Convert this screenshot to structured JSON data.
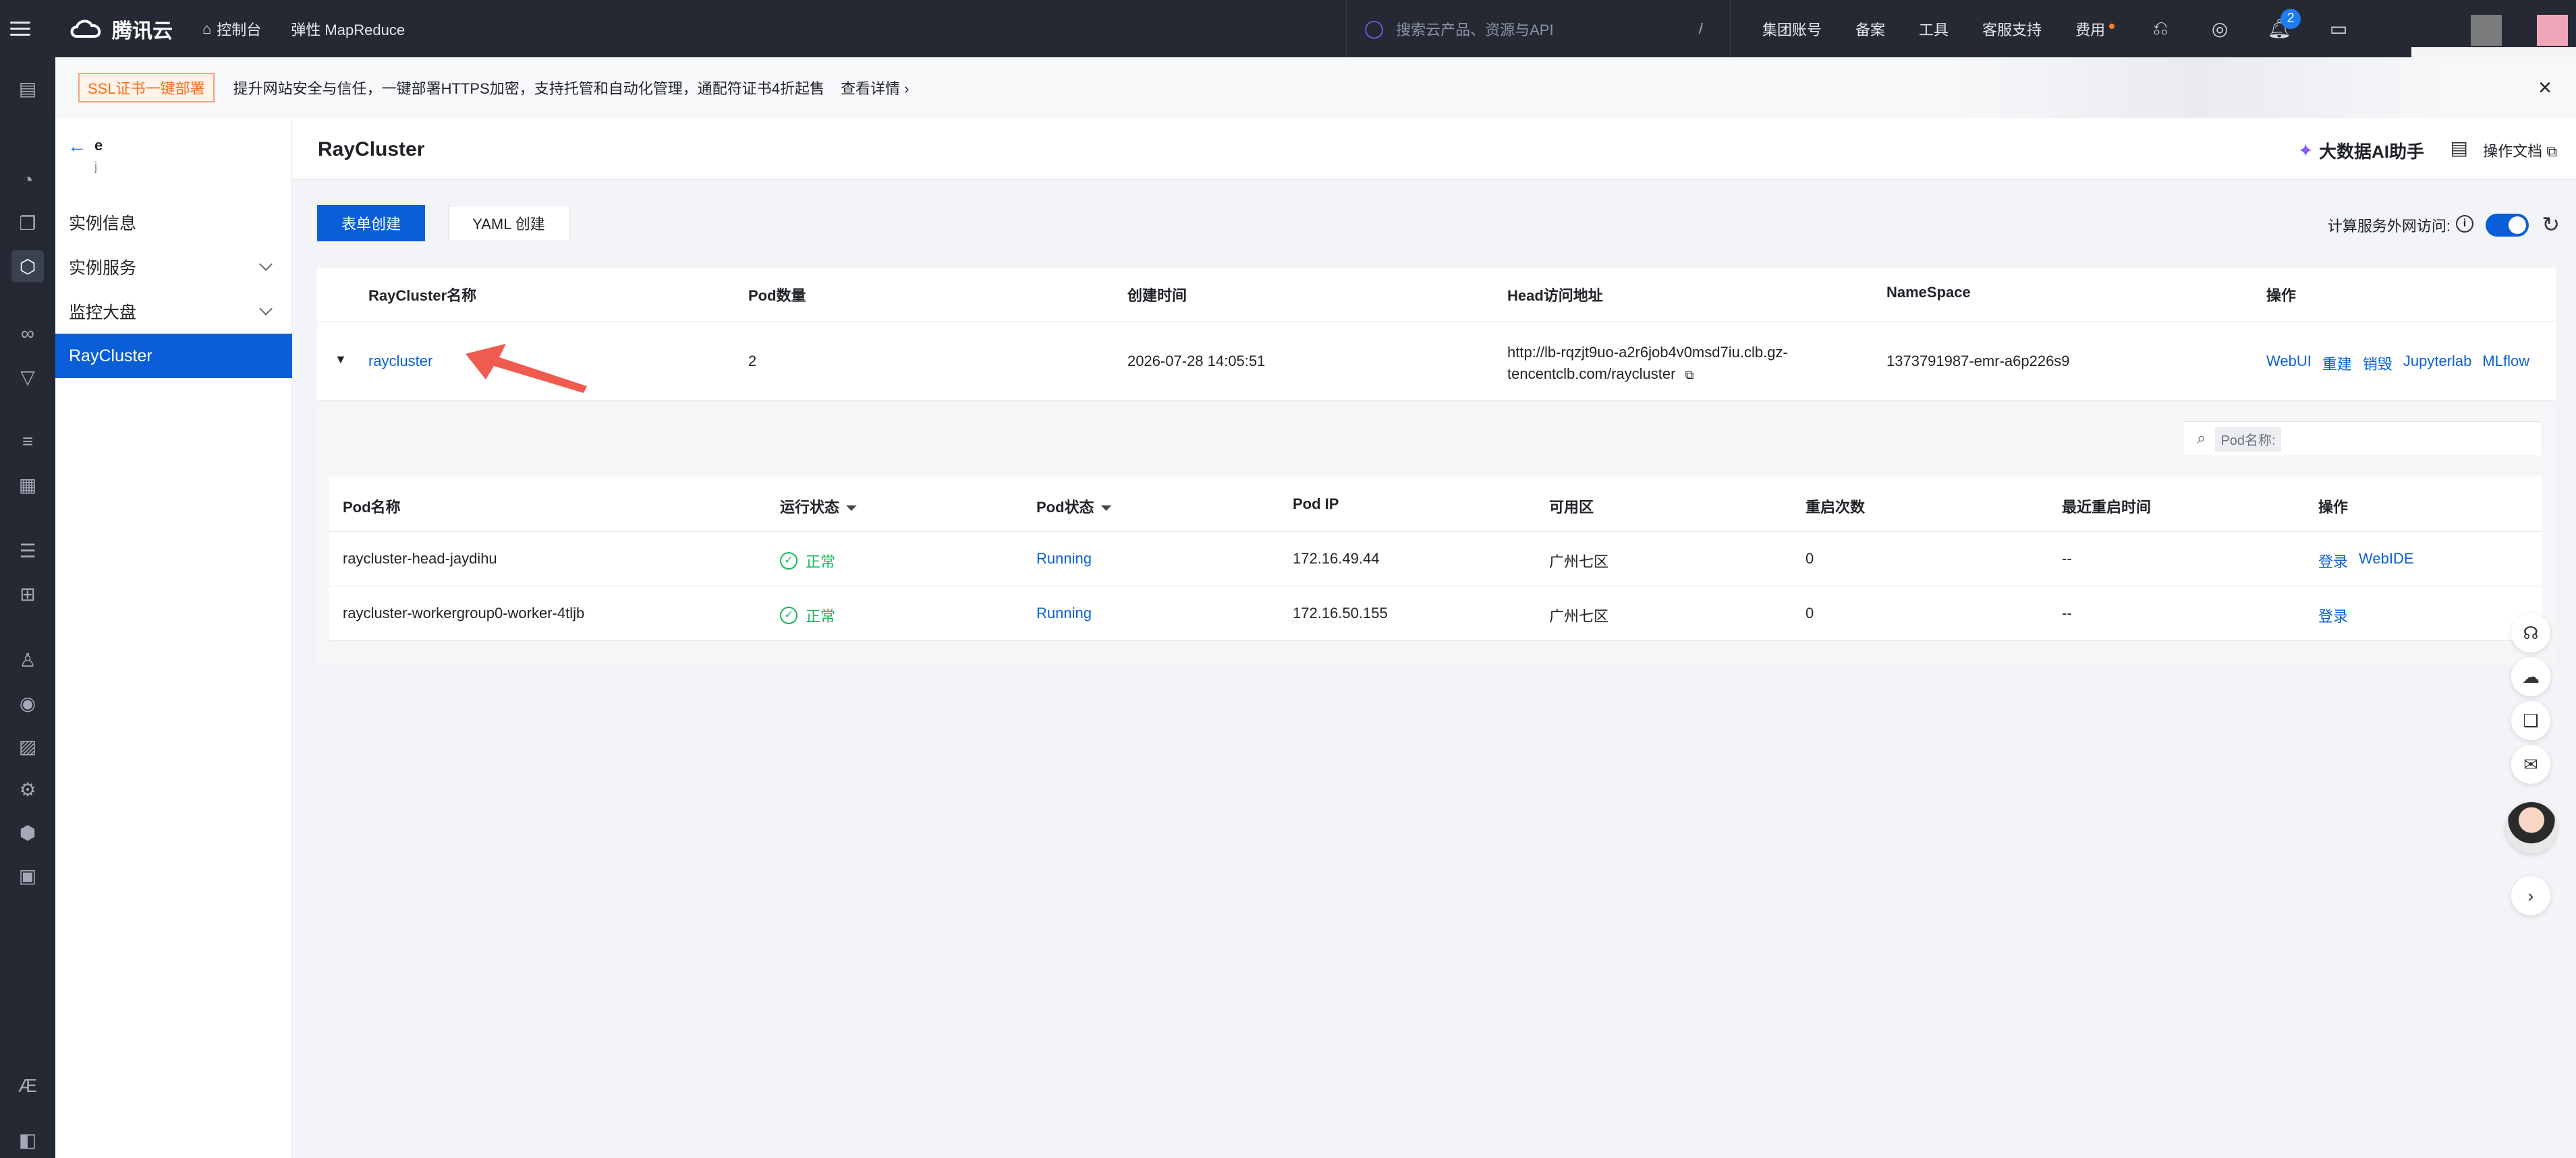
{
  "topnav": {
    "brand": "腾讯云",
    "console": "控制台",
    "product": "弹性 MapReduce",
    "search_placeholder": "搜索云产品、资源与API",
    "search_shortcut": "/",
    "links": [
      "集团账号",
      "备案",
      "工具",
      "客服支持",
      "费用"
    ],
    "notification_count": "2"
  },
  "banner": {
    "tag": "SSL证书一键部署",
    "text": "提升网站安全与信任，一键部署HTTPS加密，支持托管和自动化管理，通配符证书4折起售",
    "more": "查看详情 ›",
    "close": "×"
  },
  "subnav": {
    "instance_name": "e",
    "instance_sub": "j",
    "items": [
      {
        "label": "实例信息",
        "expandable": false
      },
      {
        "label": "实例服务",
        "expandable": true
      },
      {
        "label": "监控大盘",
        "expandable": true
      },
      {
        "label": "RayCluster",
        "expandable": false,
        "active": true
      }
    ]
  },
  "page": {
    "title": "RayCluster",
    "ai_assistant": "大数据AI助手",
    "doc_link": "操作文档",
    "btn_form": "表单创建",
    "btn_yaml": "YAML 创建",
    "net_access_label": "计算服务外网访问:",
    "net_access_enabled": true
  },
  "cluster_table": {
    "columns": [
      "RayCluster名称",
      "Pod数量",
      "创建时间",
      "Head访问地址",
      "NameSpace",
      "操作"
    ],
    "rows": [
      {
        "name": "raycluster",
        "pods": "2",
        "created": "2026-07-28 14:05:51",
        "head_url_line1": "http://lb-rqzjt9uo-a2r6job4v0msd7iu.clb.gz-",
        "head_url_line2": "tencentclb.com/raycluster",
        "namespace": "1373791987-emr-a6p226s9",
        "actions": [
          "WebUI",
          "重建",
          "销毁",
          "Jupyterlab",
          "MLflow"
        ]
      }
    ]
  },
  "pod_search": {
    "label": "Pod名称:"
  },
  "pod_table": {
    "columns": [
      "Pod名称",
      "运行状态",
      "Pod状态",
      "Pod IP",
      "可用区",
      "重启次数",
      "最近重启时间",
      "操作"
    ],
    "rows": [
      {
        "name": "raycluster-head-jaydihu",
        "run_state": "正常",
        "pod_state": "Running",
        "ip": "172.16.49.44",
        "zone": "广州七区",
        "restarts": "0",
        "last_restart": "--",
        "actions": [
          "登录",
          "WebIDE"
        ]
      },
      {
        "name": "raycluster-workergroup0-worker-4tljb",
        "run_state": "正常",
        "pod_state": "Running",
        "ip": "172.16.50.155",
        "zone": "广州七区",
        "restarts": "0",
        "last_restart": "--",
        "actions": [
          "登录"
        ]
      }
    ]
  },
  "colors": {
    "accent": "#0a5fd8",
    "success": "#1bb65e",
    "nav_bg": "#242933",
    "annotation": "#f05a4f"
  }
}
